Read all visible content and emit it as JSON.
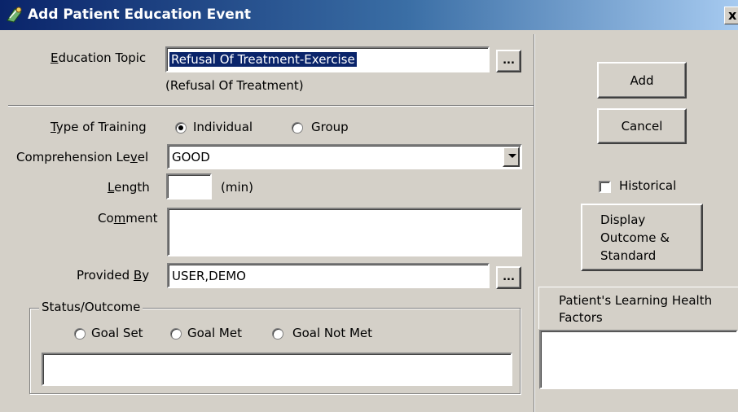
{
  "window": {
    "title": "Add Patient Education Event",
    "close_glyph": "x"
  },
  "education_topic": {
    "label_pre": "",
    "label_accel": "E",
    "label_post": "ducation Topic",
    "value": "Refusal Of Treatment-Exercise",
    "sub_value": "(Refusal Of Treatment)",
    "browse_label": "..."
  },
  "type_of_training": {
    "label_pre": "",
    "label_accel": "T",
    "label_post": "ype of Training",
    "option_individual": "Individual",
    "option_group": "Group",
    "selected": "Individual"
  },
  "comprehension_level": {
    "label_pre": "Comprehension Le",
    "label_accel": "v",
    "label_post": "el",
    "value": "GOOD"
  },
  "length": {
    "label_pre": "",
    "label_accel": "L",
    "label_post": "ength",
    "value": "",
    "unit": "(min)"
  },
  "comment": {
    "label_pre": "Co",
    "label_accel": "m",
    "label_post": "ment",
    "value": ""
  },
  "provided_by": {
    "label_pre": "Provided ",
    "label_accel": "B",
    "label_post": "y",
    "value": "USER,DEMO",
    "browse_label": "..."
  },
  "status_outcome": {
    "title": "Status/Outcome",
    "options": [
      "Goal Set",
      "Goal Met",
      "Goal Not Met"
    ],
    "selected": "",
    "note": ""
  },
  "actions": {
    "add_label": "Add",
    "cancel_label": "Cancel",
    "historical_label": "Historical",
    "historical_checked": false,
    "display_outcome_line1": "Display",
    "display_outcome_line2": "Outcome &",
    "display_outcome_line3": "Standard"
  },
  "learning_factors": {
    "title_line1": "Patient's Learning Health",
    "title_line2": "Factors",
    "items": []
  },
  "icons": {
    "app": "patient-education-icon",
    "close": "close-icon",
    "dropdown": "chevron-down-icon"
  }
}
